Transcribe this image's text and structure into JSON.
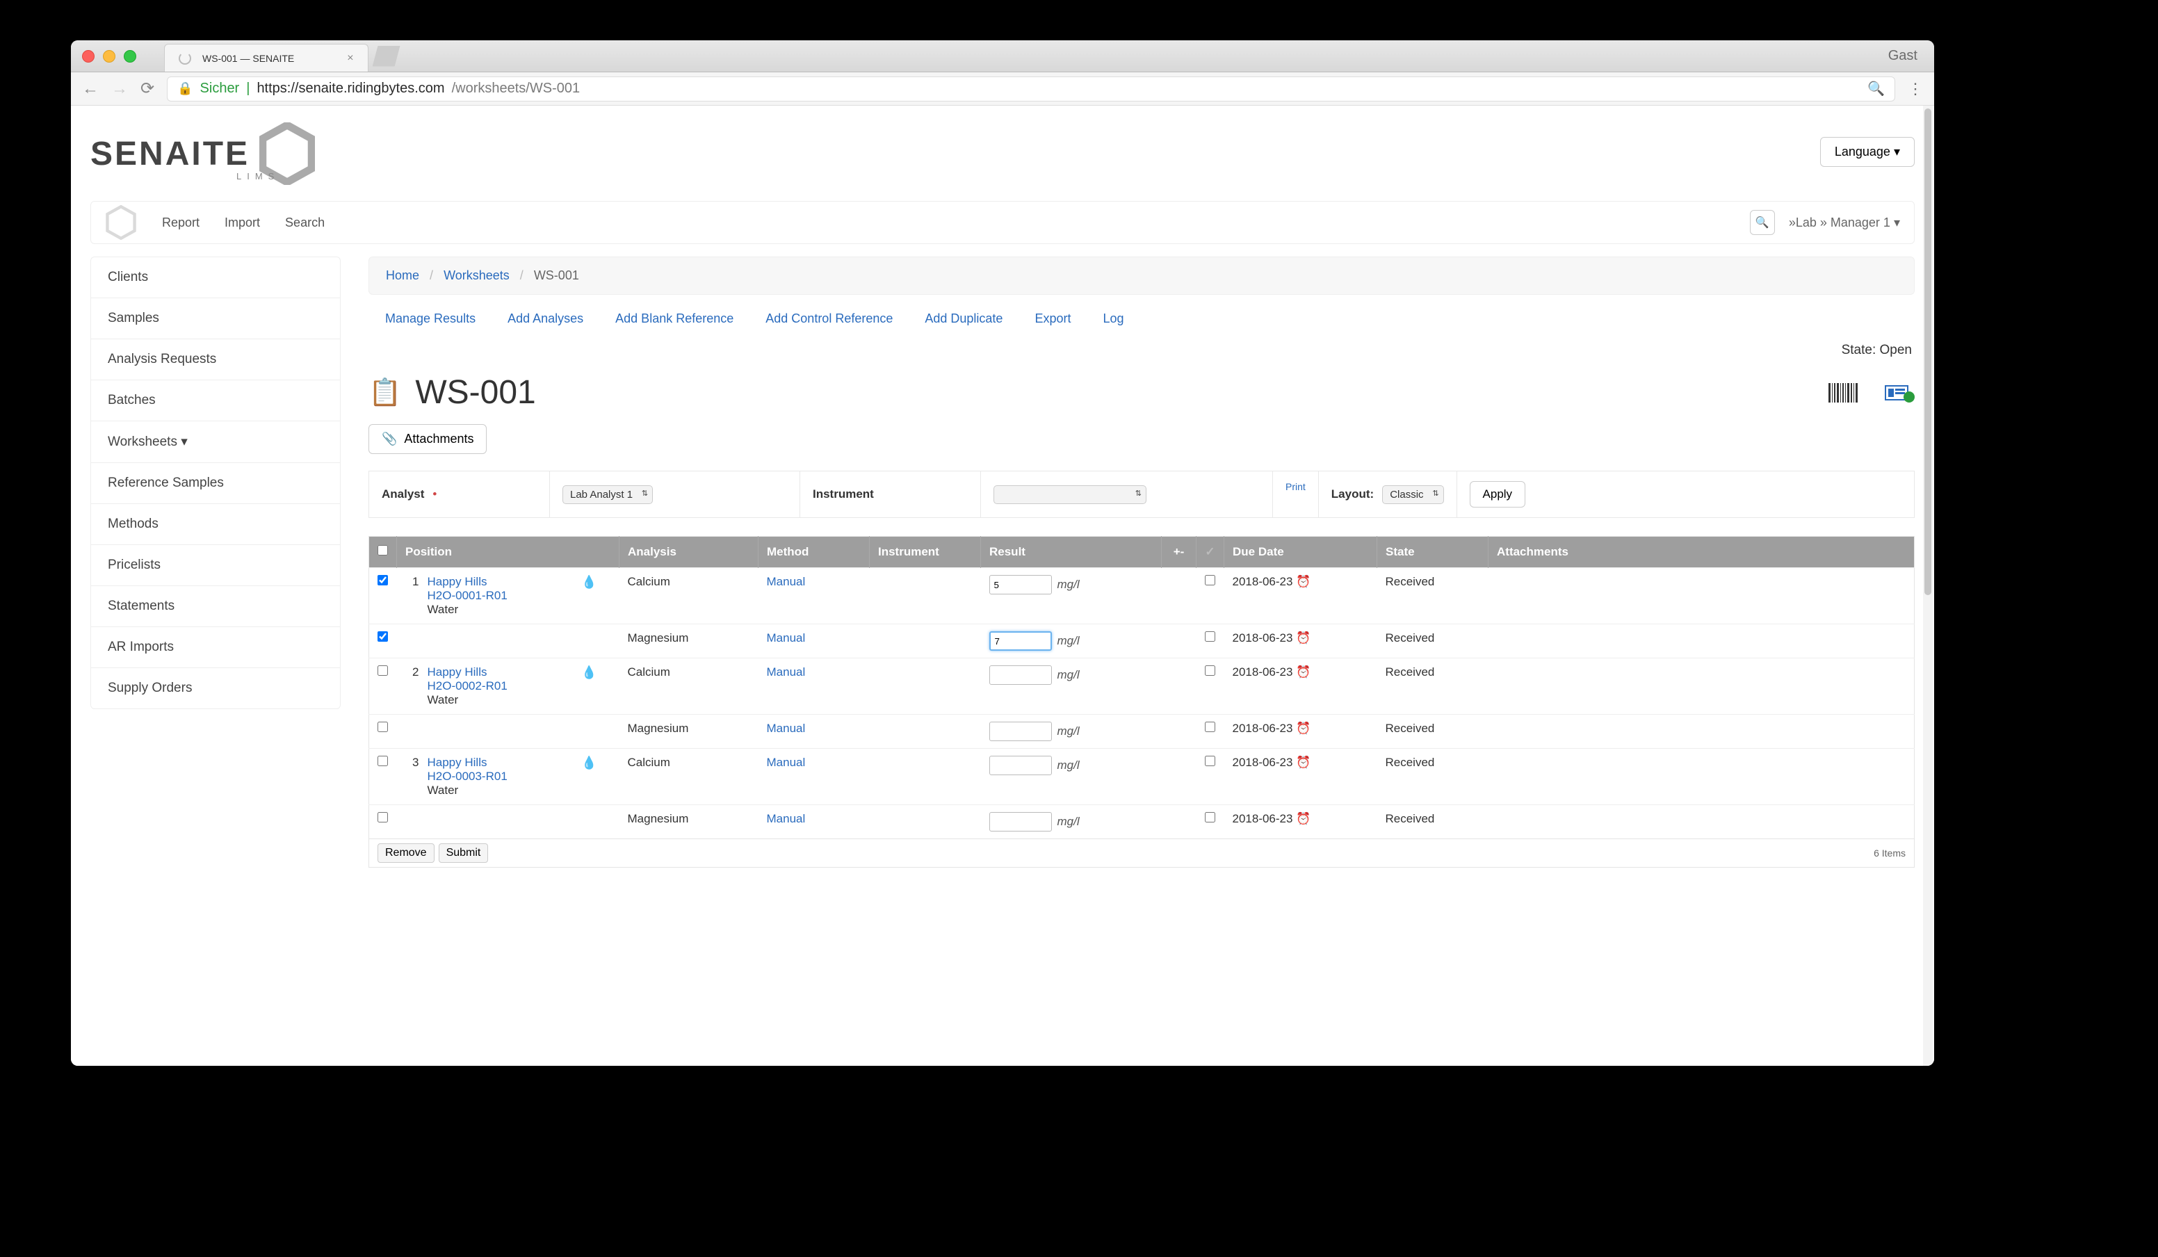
{
  "browser": {
    "guest": "Gast",
    "tab_title": "WS-001 — SENAITE",
    "secure_label": "Sicher",
    "url_origin": "https://senaite.ridingbytes.com",
    "url_path": "/worksheets/WS-001"
  },
  "header": {
    "logo_text": "SENAITE",
    "logo_sub": "LIMS",
    "language": "Language"
  },
  "topnav": {
    "report": "Report",
    "import": "Import",
    "search": "Search",
    "user": "»Lab » Manager 1"
  },
  "sidebar": {
    "items": [
      "Clients",
      "Samples",
      "Analysis Requests",
      "Batches",
      "Worksheets ▾",
      "Reference Samples",
      "Methods",
      "Pricelists",
      "Statements",
      "AR Imports",
      "Supply Orders"
    ]
  },
  "breadcrumb": {
    "home": "Home",
    "l1": "Worksheets",
    "current": "WS-001"
  },
  "actions": {
    "manage": "Manage Results",
    "add_analyses": "Add Analyses",
    "add_blank": "Add Blank Reference",
    "add_control": "Add Control Reference",
    "add_dup": "Add Duplicate",
    "export": "Export",
    "log": "Log"
  },
  "state_line": "State: Open",
  "page_title": "WS-001",
  "attachments_btn": "Attachments",
  "config": {
    "analyst_label": "Analyst",
    "analyst_value": "Lab Analyst 1",
    "instrument_label": "Instrument",
    "instrument_value": "",
    "print": "Print",
    "layout_label": "Layout:",
    "layout_value": "Classic",
    "apply": "Apply"
  },
  "table": {
    "headers": {
      "position": "Position",
      "analysis": "Analysis",
      "method": "Method",
      "instrument": "Instrument",
      "result": "Result",
      "interim": "+-",
      "verify": "✓",
      "due_date": "Due Date",
      "state": "State",
      "attachments": "Attachments"
    },
    "rows": [
      {
        "position": "1",
        "client": "Happy Hills",
        "ar": "H2O-0001-R01",
        "sample_type": "Water",
        "analysis": "Calcium",
        "method": "Manual",
        "result": "5",
        "unit": "mg/l",
        "due": "2018-06-23",
        "state": "Received",
        "checked": true
      },
      {
        "analysis": "Magnesium",
        "method": "Manual",
        "result": "7",
        "unit": "mg/l",
        "due": "2018-06-23",
        "state": "Received",
        "checked": true,
        "focused": true
      },
      {
        "position": "2",
        "client": "Happy Hills",
        "ar": "H2O-0002-R01",
        "sample_type": "Water",
        "analysis": "Calcium",
        "method": "Manual",
        "result": "",
        "unit": "mg/l",
        "due": "2018-06-23",
        "state": "Received"
      },
      {
        "analysis": "Magnesium",
        "method": "Manual",
        "result": "",
        "unit": "mg/l",
        "due": "2018-06-23",
        "state": "Received"
      },
      {
        "position": "3",
        "client": "Happy Hills",
        "ar": "H2O-0003-R01",
        "sample_type": "Water",
        "analysis": "Calcium",
        "method": "Manual",
        "result": "",
        "unit": "mg/l",
        "due": "2018-06-23",
        "state": "Received"
      },
      {
        "analysis": "Magnesium",
        "method": "Manual",
        "result": "",
        "unit": "mg/l",
        "due": "2018-06-23",
        "state": "Received"
      }
    ],
    "footer": {
      "remove": "Remove",
      "submit": "Submit",
      "items": "6 Items"
    }
  }
}
